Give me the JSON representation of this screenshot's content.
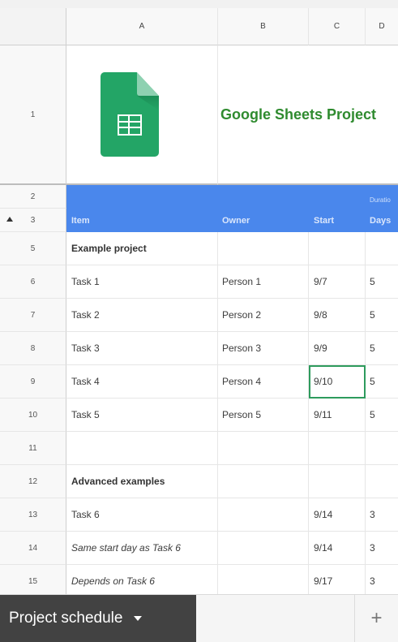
{
  "columns": [
    "A",
    "B",
    "C",
    "D"
  ],
  "title_row": {
    "num": "1",
    "title": "Google Sheets Project"
  },
  "row2": {
    "num": "2",
    "d_label": "Duratio"
  },
  "header_row": {
    "num": "3",
    "item": "Item",
    "owner": "Owner",
    "start": "Start",
    "days": "Days"
  },
  "rows": [
    {
      "num": "5",
      "item": "Example project",
      "owner": "",
      "start": "",
      "days": "",
      "style": "bold"
    },
    {
      "num": "6",
      "item": "Task 1",
      "owner": "Person 1",
      "start": "9/7",
      "days": "5"
    },
    {
      "num": "7",
      "item": "Task 2",
      "owner": "Person 2",
      "start": "9/8",
      "days": "5"
    },
    {
      "num": "8",
      "item": "Task 3",
      "owner": "Person 3",
      "start": "9/9",
      "days": "5"
    },
    {
      "num": "9",
      "item": "Task 4",
      "owner": "Person 4",
      "start": "9/10",
      "days": "5",
      "selected": true
    },
    {
      "num": "10",
      "item": "Task 5",
      "owner": "Person 5",
      "start": "9/11",
      "days": "5"
    },
    {
      "num": "11",
      "item": "",
      "owner": "",
      "start": "",
      "days": ""
    },
    {
      "num": "12",
      "item": "Advanced examples",
      "owner": "",
      "start": "",
      "days": "",
      "style": "bold"
    },
    {
      "num": "13",
      "item": "Task 6",
      "owner": "",
      "start": "9/14",
      "days": "3"
    },
    {
      "num": "14",
      "item": "Same start day as Task 6",
      "owner": "",
      "start": "9/14",
      "days": "3",
      "style": "italic"
    },
    {
      "num": "15",
      "item": "Depends on Task 6",
      "owner": "",
      "start": "9/17",
      "days": "3",
      "style": "italic"
    }
  ],
  "tabbar": {
    "active_tab": "Project schedule",
    "add_label": "+"
  },
  "colors": {
    "header_blue": "#4a87ec",
    "title_green": "#2f8b2f",
    "logo_green": "#23a566",
    "selection": "#2e9b5d",
    "tab_dark": "#424242"
  },
  "icons": {
    "logo": "google-sheets-icon",
    "collapse": "triangle-up-icon",
    "expand": "triangle-down-icon",
    "tab_menu": "caret-down-icon",
    "add_sheet": "plus-icon"
  }
}
